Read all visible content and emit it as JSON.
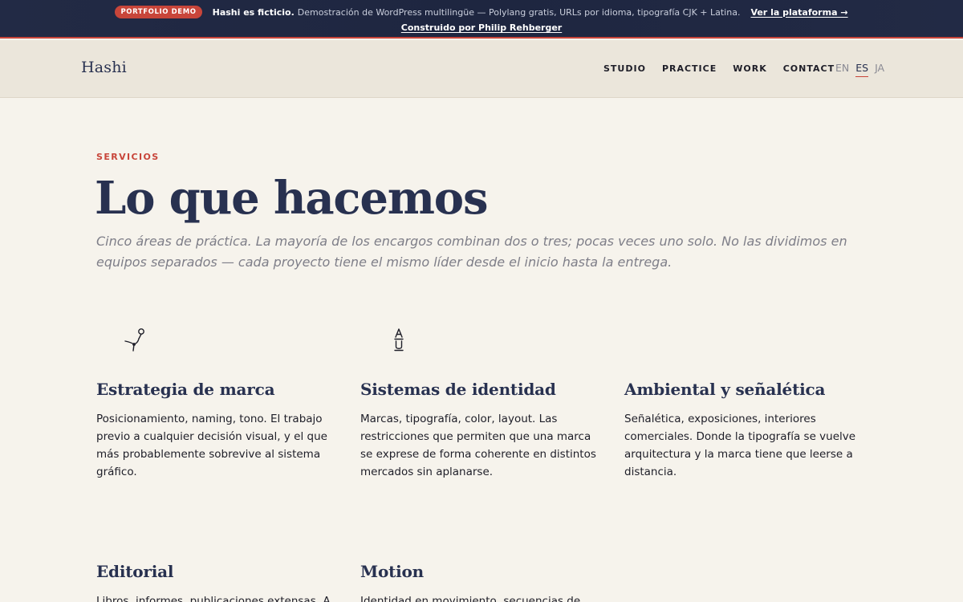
{
  "banner": {
    "badge": "PORTFOLIO DEMO",
    "strong": "Hashi es ficticio.",
    "description": "Demostración de WordPress multilingüe — Polylang gratis, URLs por idioma, tipografía CJK + Latina.",
    "platform_link": "Ver la plataforma →",
    "credit_link": "Construido por Philip Rehberger"
  },
  "header": {
    "logo": "Hashi",
    "nav": [
      "STUDIO",
      "PRACTICE",
      "WORK",
      "CONTACT"
    ],
    "languages": [
      "EN",
      "ES",
      "JA"
    ],
    "active_language": "ES"
  },
  "main": {
    "eyebrow": "SERVICIOS",
    "title": "Lo que hacemos",
    "intro": "Cinco áreas de práctica. La mayoría de los encargos combinan dos o tres; pocas veces uno solo. No las dividimos en equipos separados — cada proyecto tiene el mismo líder desde el inicio hasta la entrega."
  },
  "services": [
    {
      "title": "Estrategia de marca",
      "text": "Posicionamiento, naming, tono. El trabajo previo a cualquier decisión visual, y el que más probablemente sobrevive al sistema gráfico.",
      "icon": "path-pin-icon"
    },
    {
      "title": "Sistemas de identidad",
      "text": "Marcas, tipografía, color, layout. Las restricciones que permiten que una marca se exprese de forma coherente en distintos mercados sin aplanarse.",
      "icon": "type-specimen-icon"
    },
    {
      "title": "Ambiental y señalética",
      "text": "Señalética, exposiciones, interiores comerciales. Donde la tipografía se vuelve arquitectura y la marca tiene que leerse a distancia.",
      "icon": ""
    },
    {
      "title": "Editorial",
      "text": "Libros, informes, publicaciones extensas. A",
      "icon": ""
    },
    {
      "title": "Motion",
      "text": "Identidad en movimiento, secuencias de título",
      "icon": ""
    }
  ],
  "colors": {
    "accent": "#c8453a",
    "navy": "#283150",
    "background": "#f6f3ec"
  }
}
